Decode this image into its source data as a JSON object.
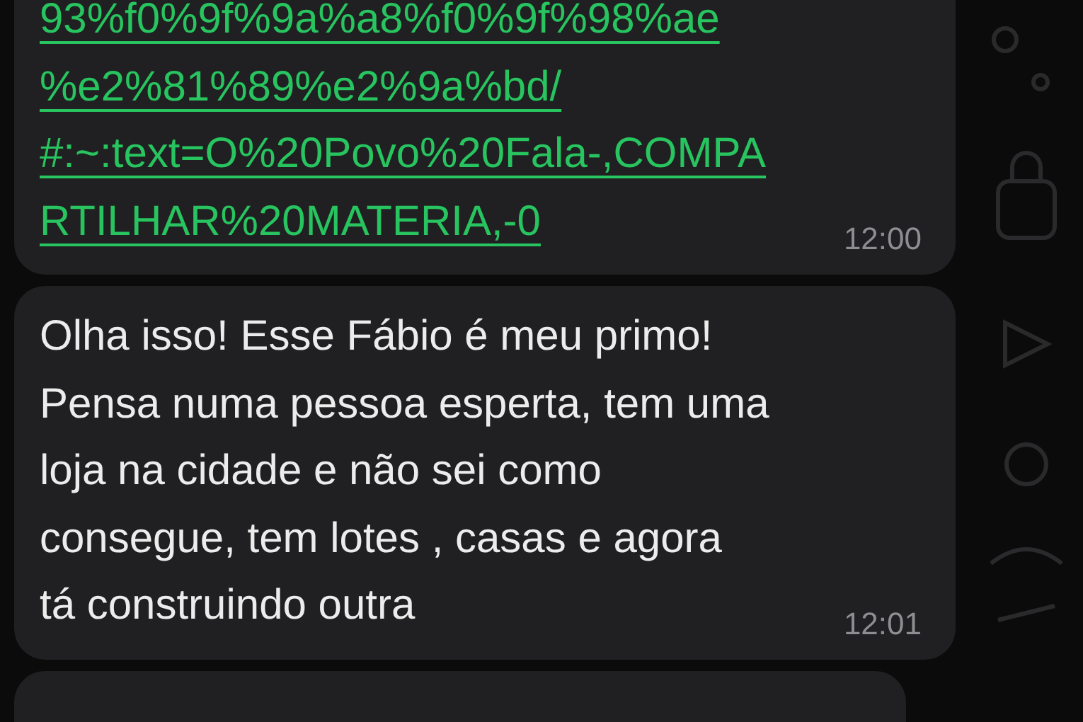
{
  "messages": [
    {
      "kind": "link",
      "lines": [
        "93%f0%9f%9a%a8%f0%9f%98%ae",
        "%e2%81%89%e2%9a%bd/",
        "#:~:text=O%20Povo%20Fala-,COMPA",
        "RTILHAR%20MATERIA,-0"
      ],
      "time": "12:00"
    },
    {
      "kind": "text",
      "lines": [
        "Olha isso! Esse Fábio é meu primo!",
        "Pensa numa pessoa esperta, tem uma",
        "loja na cidade e não sei como",
        "consegue, tem lotes , casas e agora",
        "tá construindo outra"
      ],
      "time": "12:01"
    },
    {
      "kind": "cut"
    }
  ]
}
